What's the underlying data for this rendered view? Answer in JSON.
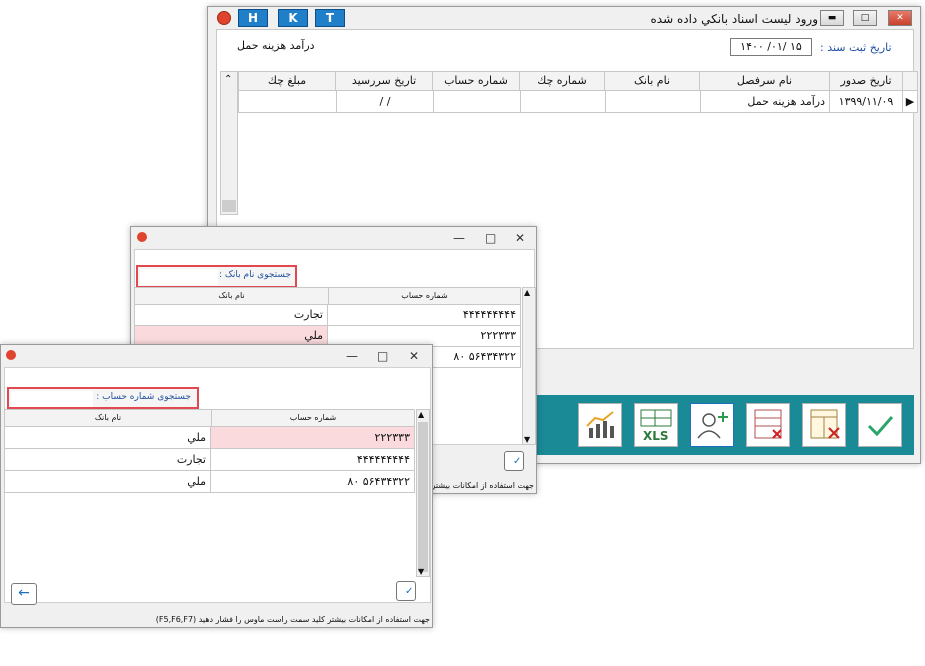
{
  "main_window": {
    "title": "ورود ليست اسناد بانکي داده شده",
    "quick_buttons": [
      "H",
      "K",
      "T"
    ],
    "date_label": "تاريخ ثبت سند :",
    "date_value": "۱۴۰۰ /۰۱/ ۱۵",
    "description": "درآمد هزينه حمل",
    "columns": [
      "تاريخ صدور",
      "نام سرفصل",
      "نام بانک",
      "شماره چك",
      "شماره حساب",
      "تاريخ سررسيد",
      "مبلغ چك"
    ],
    "row": {
      "issue_date": "۱۳۹۹/۱۱/۰۹",
      "ledger": "درآمد هزينه حمل",
      "due_date": "/ /"
    },
    "tool_icons": [
      "chart-icon",
      "excel-icon",
      "add-user-icon",
      "delete-list-icon",
      "delete-table-icon",
      "checkmark-icon"
    ]
  },
  "bank_dialog": {
    "search_label": "جستجوی  نام بانک :",
    "columns": [
      "شماره حساب",
      "نام بانک"
    ],
    "rows": [
      {
        "account": "۴۴۴۴۴۴۴۴۴",
        "bank": "تجارت"
      },
      {
        "account": "۲۲۲۳۳۳",
        "bank": "ملي"
      },
      {
        "account": "۸۰ ۵۶۴۳۴۳۲۲",
        "bank": ""
      }
    ],
    "footer": "جهت استفاده از امکانات بيشتر"
  },
  "account_dialog": {
    "search_label": "جستجوی  شماره حساب :",
    "columns": [
      "شماره حساب",
      "نام بانک"
    ],
    "rows": [
      {
        "account": "۲۲۲۳۳۳",
        "bank": "ملي"
      },
      {
        "account": "۴۴۴۴۴۴۴۴۴",
        "bank": "تجارت"
      },
      {
        "account": "۸۰ ۵۶۴۳۴۳۲۲",
        "bank": "ملي"
      }
    ],
    "footer": "جهت استفاده از امکانات بيشتر کليد سمت راست ماوس را فشار دهيد (F5,F6,F7)"
  }
}
